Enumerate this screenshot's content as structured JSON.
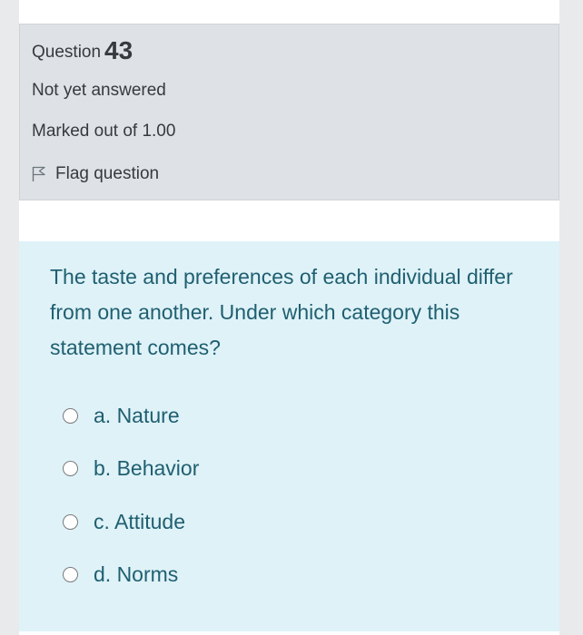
{
  "question_info": {
    "label": "Question",
    "number": "43",
    "state": "Not yet answered",
    "grade": "Marked out of 1.00",
    "flag_label": "Flag question",
    "flag_icon": "flag-outline-icon"
  },
  "question": {
    "text": "The taste and preferences of each individual differ from one another. Under which category this statement comes?",
    "options": [
      {
        "label": "a. Nature"
      },
      {
        "label": "b. Behavior"
      },
      {
        "label": "c. Attitude"
      },
      {
        "label": "d. Norms"
      }
    ]
  },
  "colors": {
    "info_background": "#dee2e6",
    "content_background": "#def2f8",
    "question_text": "#1f5f70",
    "info_text": "#373a3c"
  }
}
